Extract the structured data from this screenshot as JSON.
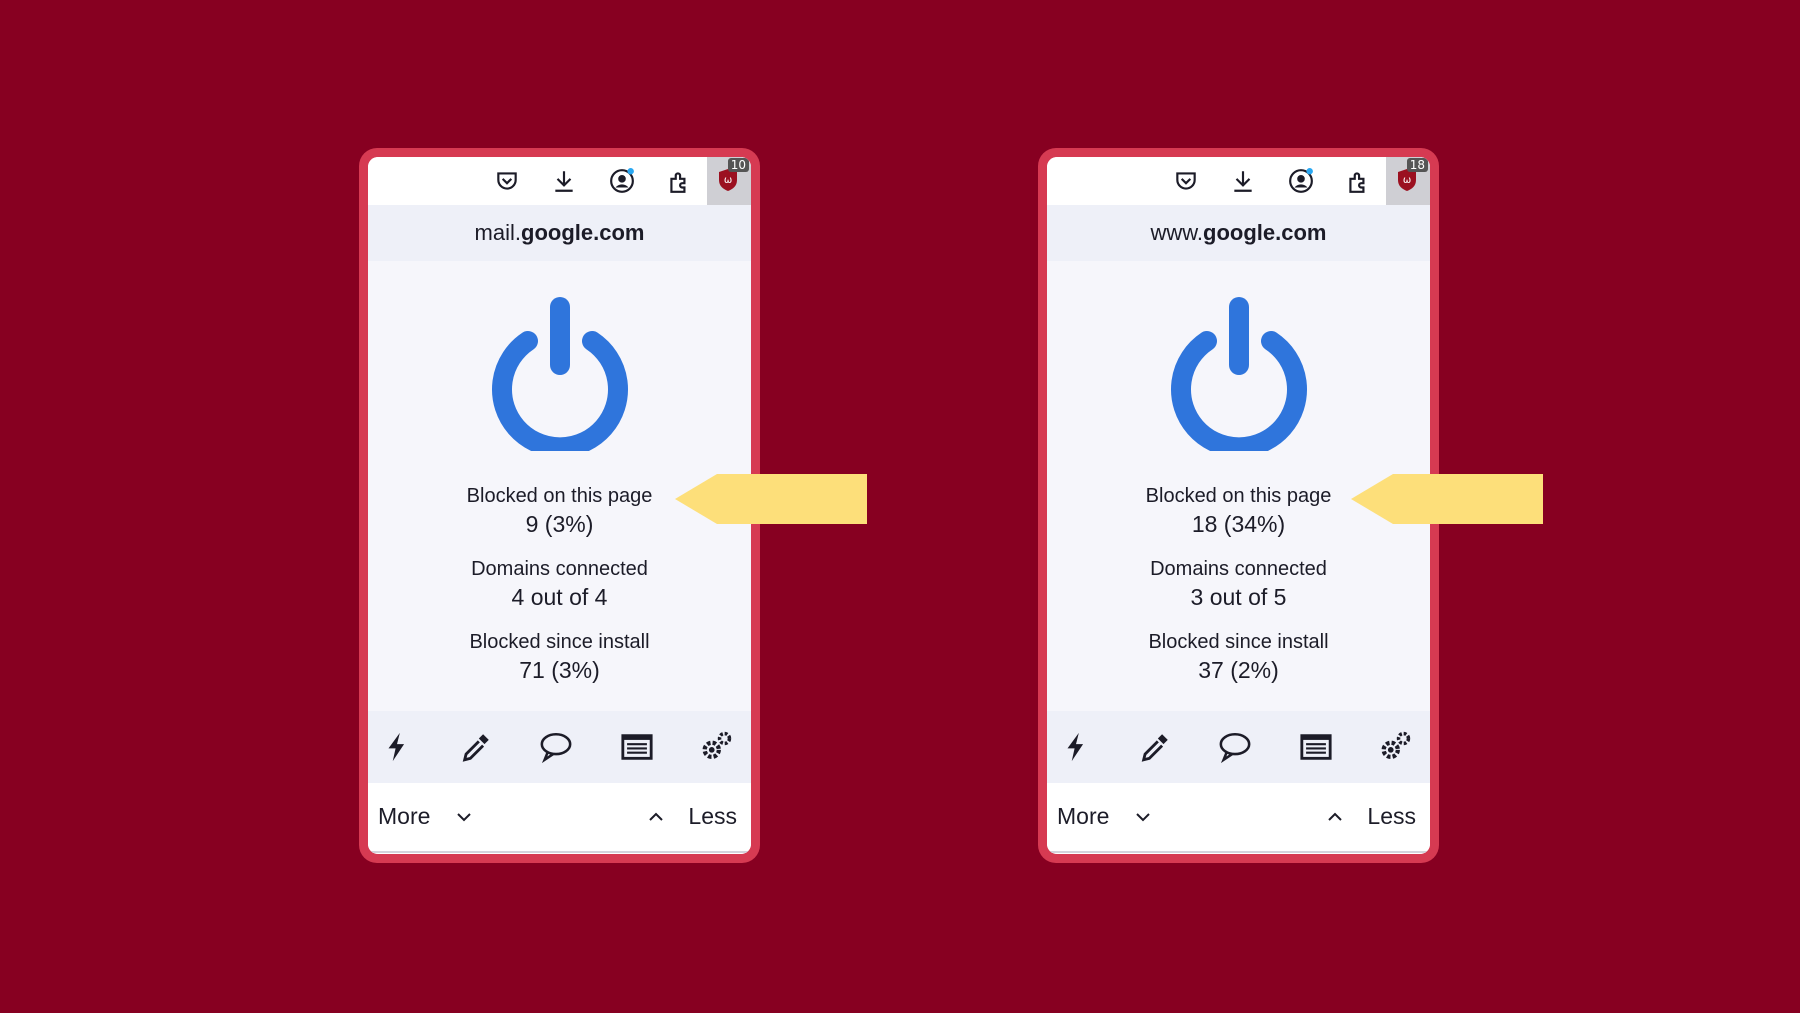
{
  "panels": [
    {
      "extension_badge": "10",
      "domain_prefix": "mail.",
      "domain_main": "google.com",
      "blocked_page_label": "Blocked on this page",
      "blocked_page_value": "9 (3%)",
      "domains_label": "Domains connected",
      "domains_value": "4 out of 4",
      "blocked_install_label": "Blocked since install",
      "blocked_install_value": "71 (3%)",
      "more_label": "More",
      "less_label": "Less"
    },
    {
      "extension_badge": "18",
      "domain_prefix": "www.",
      "domain_main": "google.com",
      "blocked_page_label": "Blocked on this page",
      "blocked_page_value": "18 (34%)",
      "domains_label": "Domains connected",
      "domains_value": "3 out of 5",
      "blocked_install_label": "Blocked since install",
      "blocked_install_value": "37 (2%)",
      "more_label": "More",
      "less_label": "Less"
    }
  ],
  "icons": {
    "toolbar": [
      "pocket-icon",
      "download-icon",
      "account-icon",
      "extensions-icon",
      "ublock-icon"
    ],
    "tools": [
      "lightning-icon",
      "eyedropper-icon",
      "speech-bubble-icon",
      "logger-list-icon",
      "settings-gears-icon"
    ]
  },
  "colors": {
    "background": "#870021",
    "panel_border": "#d63a52",
    "power_blue": "#2f75dc",
    "arrow_yellow": "#fddf7a"
  }
}
